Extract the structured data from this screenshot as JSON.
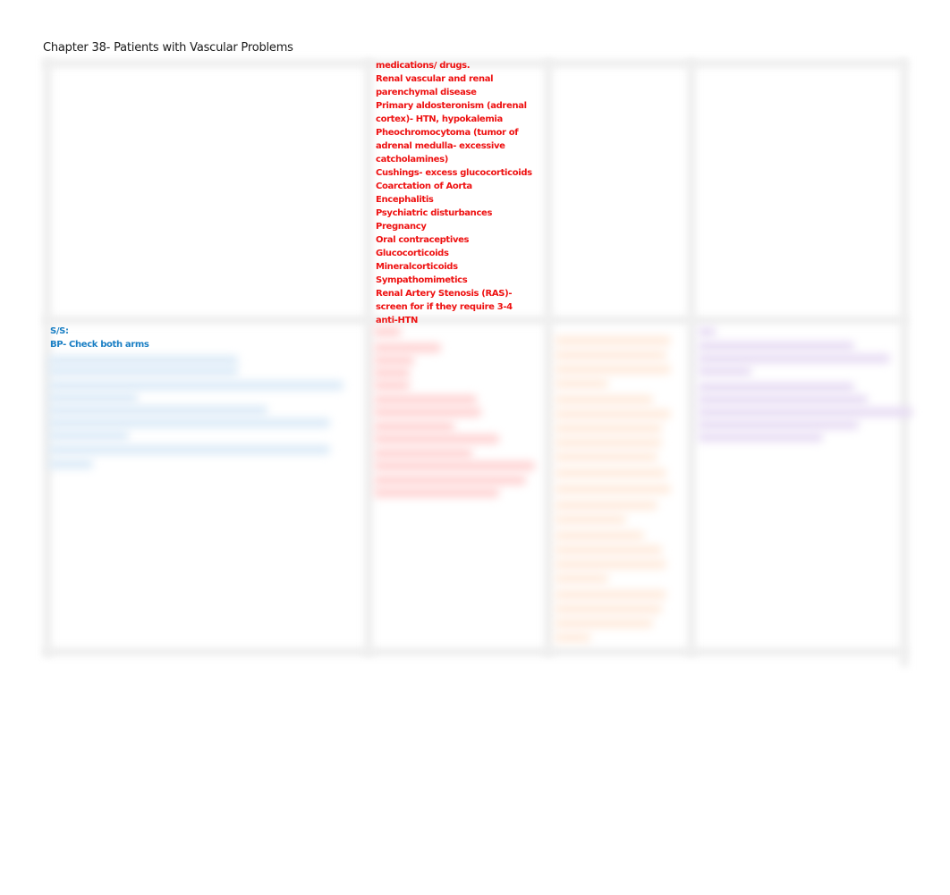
{
  "document": {
    "title": "Chapter 38- Patients with Vascular Problems"
  },
  "colors": {
    "causes_text": "#ee1111",
    "signs_text": "#1a7fc4",
    "blurred_red": "#ffd6d6",
    "blurred_blue": "#d9e9f7",
    "blurred_orange": "#fff0e4",
    "blurred_purple": "#ece2f6",
    "gridline": "#efefef"
  },
  "table": {
    "row1": {
      "causes_cell": {
        "lines": [
          "medications/ drugs.",
          "Renal vascular and renal parenchymal disease",
          "Primary aldosteronism (adrenal cortex)- HTN, hypokalemia",
          "Pheochromocytoma (tumor of adrenal medulla- excessive catcholamines)",
          "Cushings- excess glucocorticoids",
          "Coarctation of Aorta",
          "Encephalitis",
          "Psychiatric disturbances",
          "Pregnancy",
          "Oral contraceptives",
          "Glucocorticoids",
          "Mineralcorticoids",
          "Sympathomimetics",
          "Renal Artery Stenosis (RAS)- screen for if they require 3-4 anti-HTN"
        ]
      }
    },
    "row2": {
      "signs_cell": {
        "heading": "S/S:",
        "first_item": "BP- Check both arms",
        "obscured": true
      },
      "column2_cell": {
        "obscured": true
      },
      "column3_cell": {
        "obscured": true
      },
      "column4_cell": {
        "obscured": true
      }
    }
  }
}
